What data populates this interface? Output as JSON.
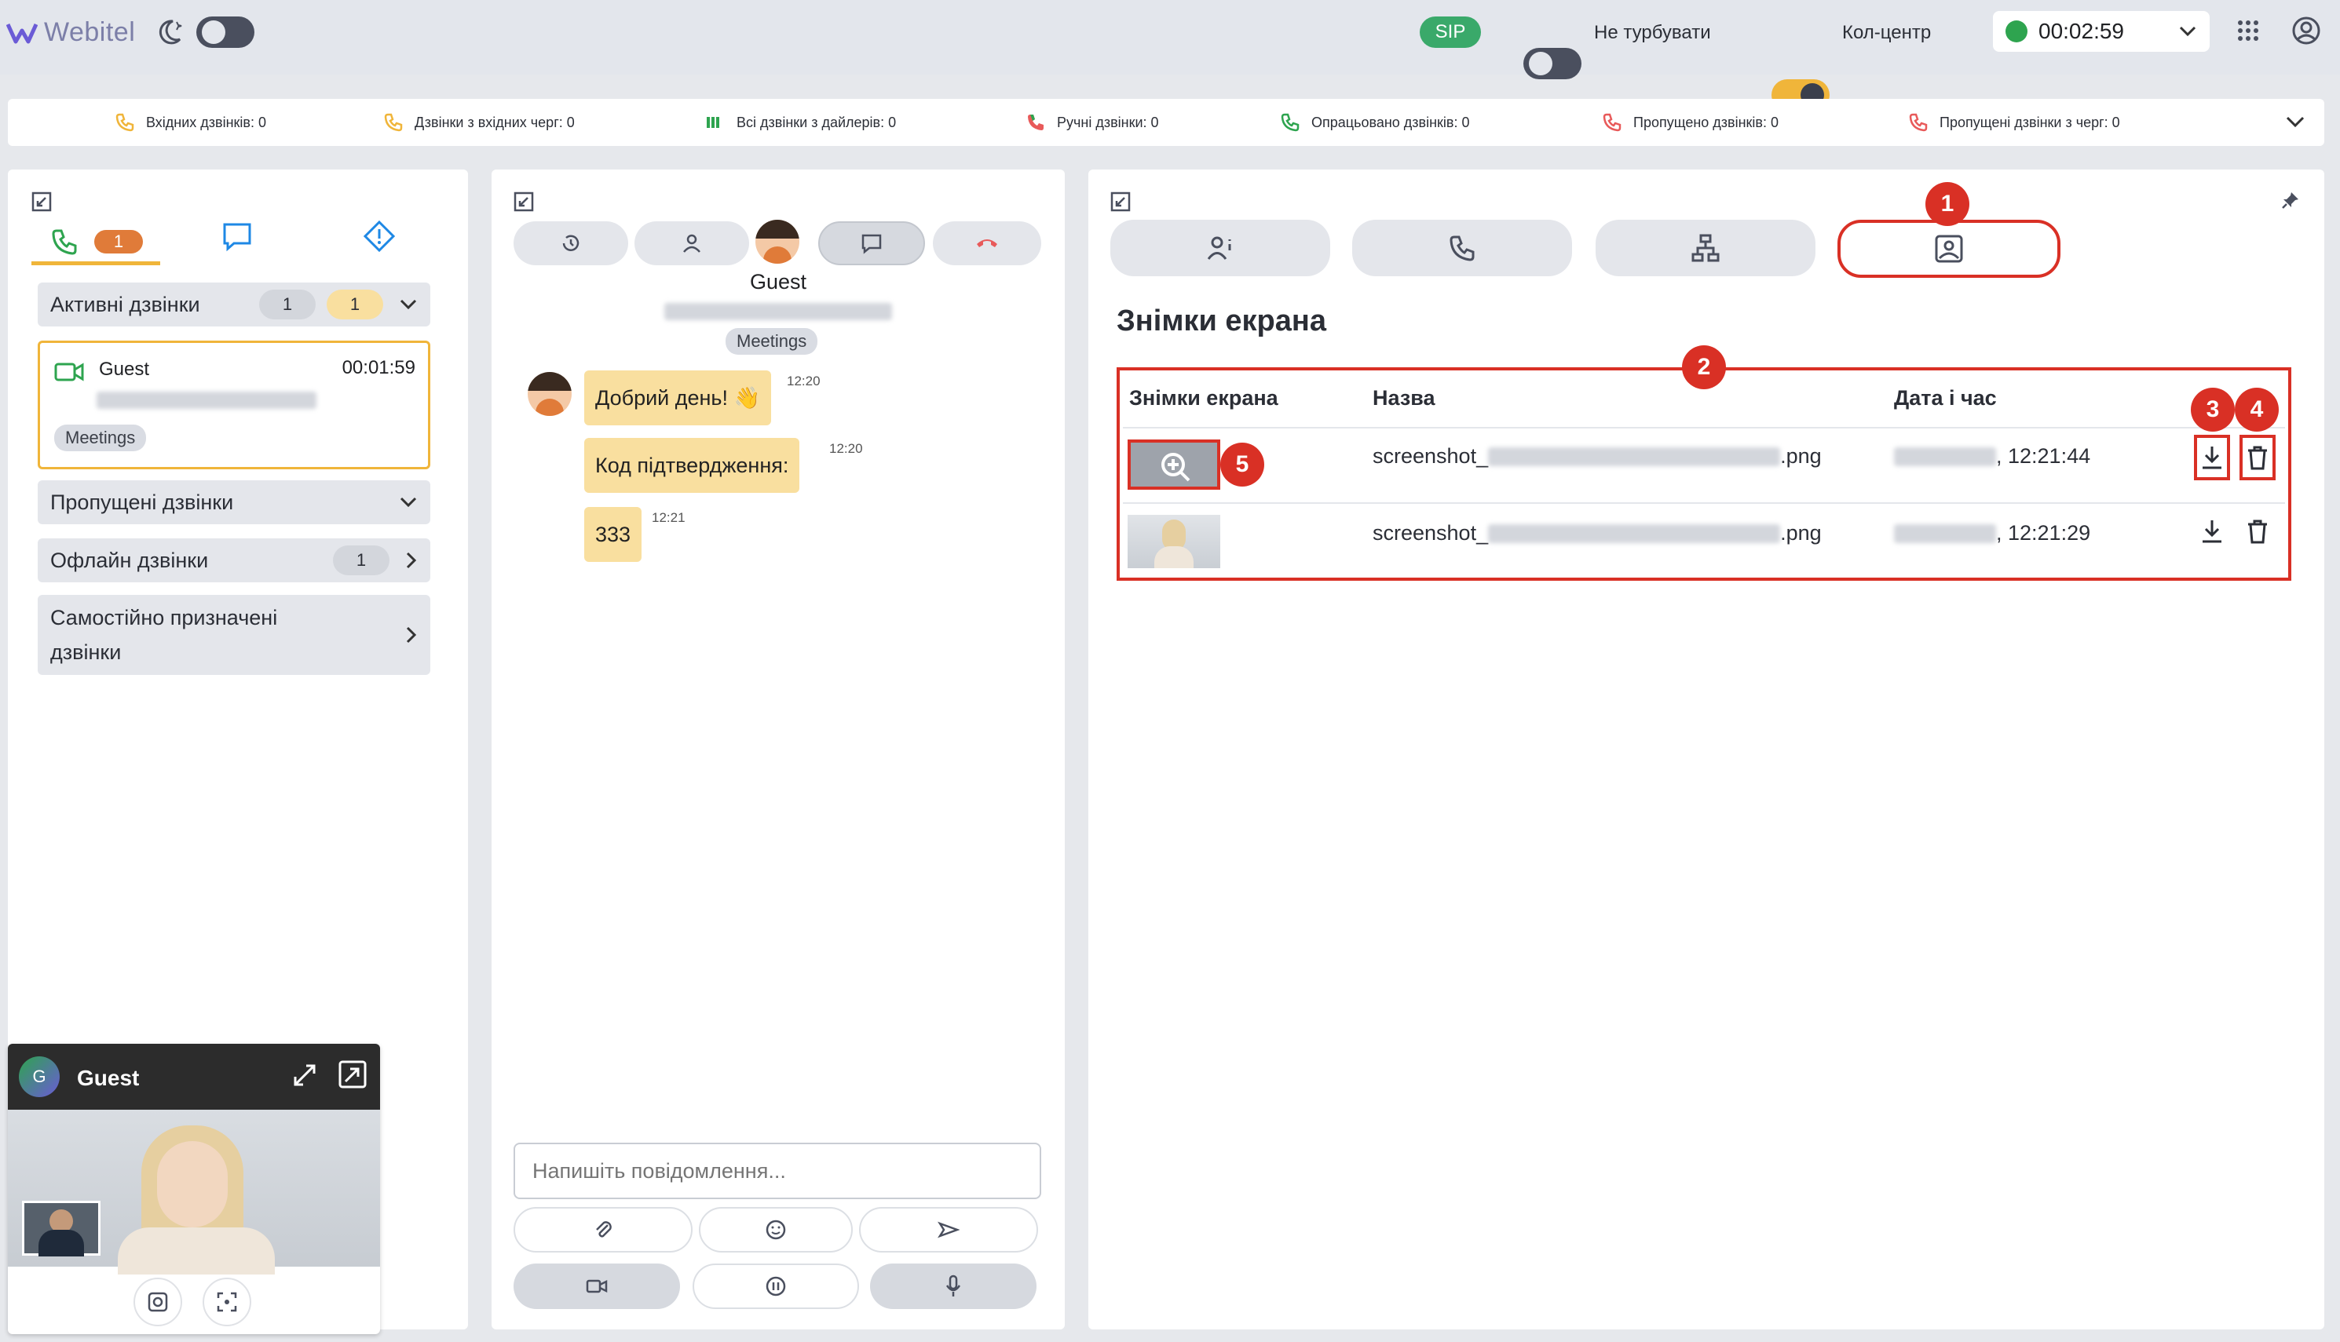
{
  "app": {
    "title": "Webitel"
  },
  "topbar": {
    "sip": "SIP",
    "dnd_label": "Не турбувати",
    "callcenter_label": "Кол-центр",
    "timer": "00:02:59"
  },
  "stats": [
    {
      "label": "Вхідних дзвінків: 0",
      "color": "#f0b53a"
    },
    {
      "label": "Дзвінки з вхідних черг: 0",
      "color": "#f0b53a"
    },
    {
      "label": "Всі дзвінки з дайлерів: 0",
      "color": "#2ea44f"
    },
    {
      "label": "Ручні дзвінки: 0",
      "color": "#e85a5a"
    },
    {
      "label": "Опрацьовано дзвінків: 0",
      "color": "#2ea44f"
    },
    {
      "label": "Пропущено дзвінків: 0",
      "color": "#e85a5a"
    },
    {
      "label": "Пропущені дзвінки з черг: 0",
      "color": "#e85a5a"
    }
  ],
  "left": {
    "tab_badge": "1",
    "active_calls": {
      "label": "Активні дзвінки",
      "count_a": "1",
      "count_b": "1"
    },
    "active_card": {
      "name": "Guest",
      "time": "00:01:59",
      "tag": "Meetings"
    },
    "missed": {
      "label": "Пропущені дзвінки"
    },
    "offline": {
      "label": "Офлайн дзвінки",
      "count": "1"
    },
    "self_assigned": {
      "line1": "Самостійно призначені",
      "line2": "дзвінки"
    }
  },
  "video": {
    "avatar_letter": "G",
    "name": "Guest"
  },
  "chat": {
    "contact_name": "Guest",
    "tag": "Meetings",
    "messages": [
      {
        "text": "Добрий день! 👋",
        "time": "12:20"
      },
      {
        "text": "Код підтвердження:",
        "time": "12:20"
      },
      {
        "text": "333",
        "time": "12:21"
      }
    ],
    "input_placeholder": "Напишіть повідомлення..."
  },
  "right": {
    "title": "Знімки екрана",
    "table": {
      "headers": [
        "Знімки екрана",
        "Назва",
        "Дата і час"
      ],
      "rows": [
        {
          "name_prefix": "screenshot_",
          "name_suffix": ".png",
          "time": ", 12:21:44"
        },
        {
          "name_prefix": "screenshot_",
          "name_suffix": ".png",
          "time": ", 12:21:29"
        }
      ]
    },
    "callouts": [
      "1",
      "2",
      "3",
      "4",
      "5"
    ]
  },
  "colors": {
    "accent": "#f0b53a",
    "danger": "#d93025",
    "success": "#2ea44f",
    "bubble": "#f9df9f"
  }
}
